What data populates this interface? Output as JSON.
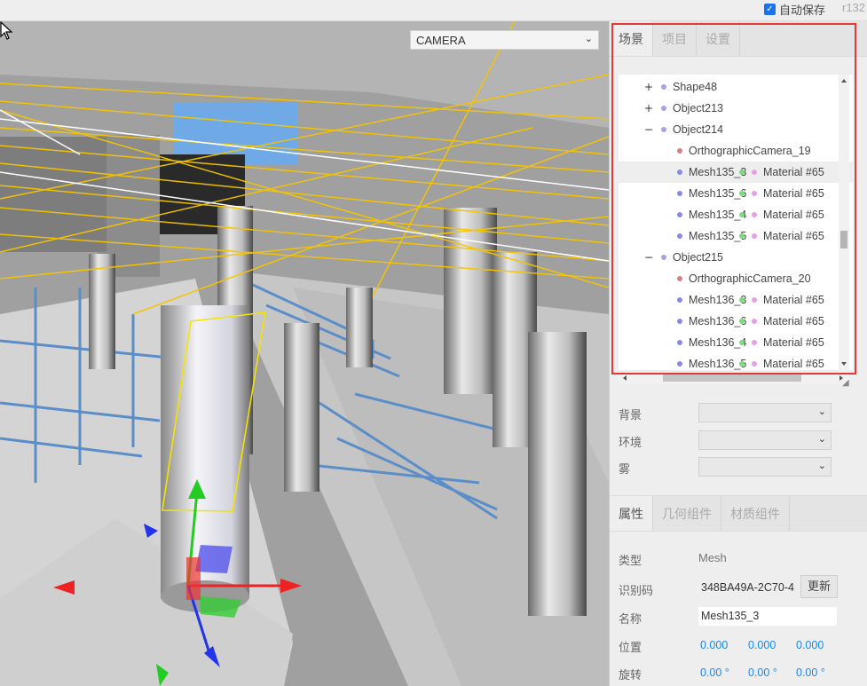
{
  "menubar": {
    "autosave_label": "自动保存",
    "autosave_checked": true,
    "version": "r132"
  },
  "viewport": {
    "camera_select_value": "CAMERA"
  },
  "sidebar": {
    "tabs": [
      {
        "label": "场景",
        "active": true
      },
      {
        "label": "项目",
        "active": false
      },
      {
        "label": "设置",
        "active": false
      }
    ],
    "outliner": {
      "rows": [
        {
          "toggle": "+",
          "name": "Shape48",
          "dot_color": "#a8a2e6",
          "level": 0
        },
        {
          "toggle": "+",
          "name": "Object213",
          "dot_color": "#a8a2e6",
          "level": 0
        },
        {
          "toggle": "−",
          "name": "Object214",
          "dot_color": "#a8a2e6",
          "level": 0
        },
        {
          "toggle": "",
          "name": "OrthographicCamera_19",
          "dot_color": "#d98080",
          "level": 1
        },
        {
          "toggle": "",
          "name": "Mesh135_3",
          "dot_color": "#8a8ae6",
          "level": 1,
          "selected": true,
          "geo_dot": "#7bdc7b",
          "material": "Material #65",
          "mat_dot": "#e6a0e6"
        },
        {
          "toggle": "",
          "name": "Mesh135_6",
          "dot_color": "#8a8ae6",
          "level": 1,
          "geo_dot": "#7bdc7b",
          "material": "Material #65",
          "mat_dot": "#e6a0e6"
        },
        {
          "toggle": "",
          "name": "Mesh135_4",
          "dot_color": "#8a8ae6",
          "level": 1,
          "geo_dot": "#7bdc7b",
          "material": "Material #65",
          "mat_dot": "#e6a0e6"
        },
        {
          "toggle": "",
          "name": "Mesh135_5",
          "dot_color": "#8a8ae6",
          "level": 1,
          "geo_dot": "#7bdc7b",
          "material": "Material #65",
          "mat_dot": "#e6a0e6"
        },
        {
          "toggle": "−",
          "name": "Object215",
          "dot_color": "#a8a2e6",
          "level": 0
        },
        {
          "toggle": "",
          "name": "OrthographicCamera_20",
          "dot_color": "#d98080",
          "level": 1
        },
        {
          "toggle": "",
          "name": "Mesh136_3",
          "dot_color": "#8a8ae6",
          "level": 1,
          "geo_dot": "#7bdc7b",
          "material": "Material #65",
          "mat_dot": "#e6a0e6"
        },
        {
          "toggle": "",
          "name": "Mesh136_6",
          "dot_color": "#8a8ae6",
          "level": 1,
          "geo_dot": "#7bdc7b",
          "material": "Material #65",
          "mat_dot": "#e6a0e6"
        },
        {
          "toggle": "",
          "name": "Mesh136_4",
          "dot_color": "#8a8ae6",
          "level": 1,
          "geo_dot": "#7bdc7b",
          "material": "Material #65",
          "mat_dot": "#e6a0e6"
        },
        {
          "toggle": "",
          "name": "Mesh136_5",
          "dot_color": "#8a8ae6",
          "level": 1,
          "geo_dot": "#7bdc7b",
          "material": "Material #65",
          "mat_dot": "#e6a0e6"
        }
      ]
    },
    "scene_settings": {
      "background_label": "背景",
      "environment_label": "环境",
      "fog_label": "雾"
    },
    "properties": {
      "tabs": [
        {
          "label": "属性",
          "active": true
        },
        {
          "label": "几何组件",
          "active": false
        },
        {
          "label": "材质组件",
          "active": false
        }
      ],
      "type_label": "类型",
      "type_value": "Mesh",
      "uuid_label": "识别码",
      "uuid_value": "348BA49A-2C70-4",
      "update_button": "更新",
      "name_label": "名称",
      "name_value": "Mesh135_3",
      "position_label": "位置",
      "position": [
        "0.000",
        "0.000",
        "0.000"
      ],
      "rotation_label": "旋转",
      "rotation": [
        "0.00 °",
        "0.00 °",
        "0.00 °"
      ]
    }
  },
  "colors": {
    "accent": "#1e88e5",
    "highlight_frame": "#e53935"
  }
}
